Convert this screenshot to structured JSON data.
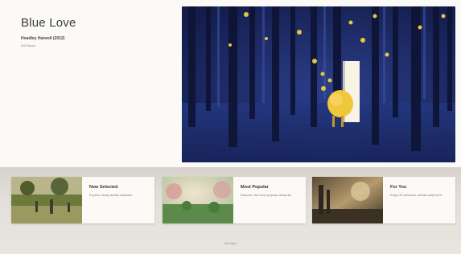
{
  "header": {
    "title": "Blue Love",
    "subtitle": "Hoadley Harwell (2012)",
    "artist": "Art Repair"
  },
  "feature": {
    "image": "forest-painting-blue-love"
  },
  "collections": [
    {
      "title": "New Selected",
      "desc": "Explore newly added artworks.",
      "image": "park-painting"
    },
    {
      "title": "Most Popular",
      "desc": "Discover the most popular artworks.",
      "image": "meadow-painting"
    },
    {
      "title": "For You",
      "desc": "Enjoy 25 artworks. Ahead daily from.",
      "image": "landscape-painting"
    }
  ],
  "footer": {
    "label": "Spotlight"
  },
  "colors": {
    "background": "#f4f2ee",
    "shelf": "#e3dfd8",
    "feature": "#1e2a63"
  }
}
